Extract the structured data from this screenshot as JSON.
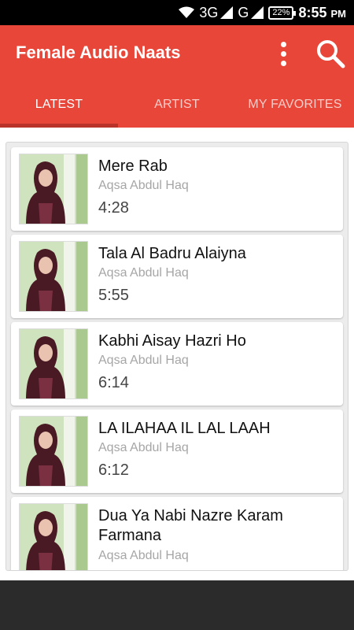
{
  "status_bar": {
    "network_3g": "3G",
    "network_g": "G",
    "battery": "22%",
    "time": "8:55",
    "ampm": "PM"
  },
  "app_bar": {
    "title": "Female Audio Naats",
    "background_color": "#e9463a",
    "overflow_icon": "more-vert-icon",
    "search_icon": "search-icon"
  },
  "tabs": [
    {
      "label": "LATEST",
      "active": true
    },
    {
      "label": "ARTIST",
      "active": false
    },
    {
      "label": "MY FAVORITES",
      "active": false
    }
  ],
  "songs": [
    {
      "title": "Mere Rab",
      "artist": "Aqsa Abdul Haq",
      "duration": "4:28"
    },
    {
      "title": "Tala Al Badru Alaiyna",
      "artist": "Aqsa Abdul Haq",
      "duration": "5:55"
    },
    {
      "title": "Kabhi Aisay Hazri Ho",
      "artist": "Aqsa Abdul Haq",
      "duration": "6:14"
    },
    {
      "title": "LA ILAHAA IL LAL LAAH",
      "artist": "Aqsa Abdul Haq",
      "duration": "6:12"
    },
    {
      "title": "Dua Ya Nabi Nazre Karam Farmana",
      "artist": "Aqsa Abdul Haq",
      "duration": ""
    }
  ]
}
